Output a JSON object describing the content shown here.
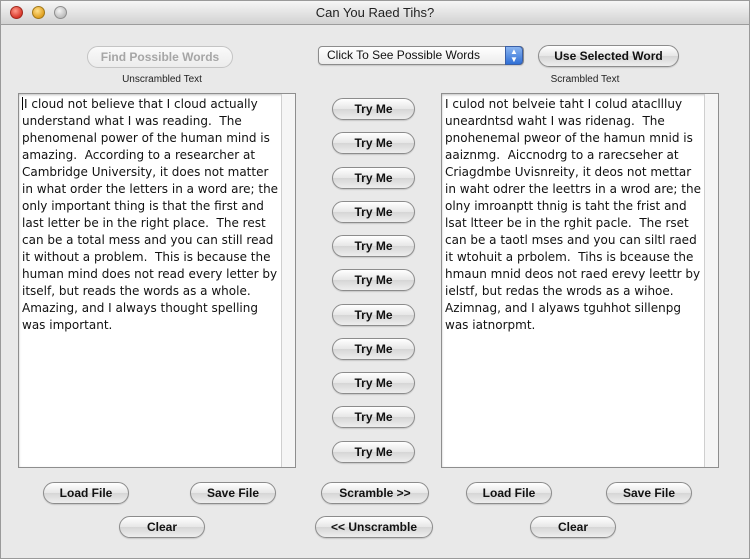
{
  "window": {
    "title": "Can You Raed Tihs?"
  },
  "top": {
    "find_words_label": "Find Possible Words",
    "popup_value": "Click To See Possible Words",
    "use_word_label": "Use Selected Word"
  },
  "left": {
    "heading": "Unscrambled Text",
    "text": "I cloud not believe that I cloud actually understand what I was reading.  The phenomenal power of the human mind is amazing.  According to a researcher at Cambridge University, it does not matter in what order the letters in a word are; the only important thing is that the first and last letter be in the right place.  The rest can be a total mess and you can still read it without a problem.  This is because the human mind does not read every letter by itself, but reads the words as a whole. Amazing, and I always thought spelling was important.",
    "load_label": "Load File",
    "save_label": "Save File",
    "clear_label": "Clear"
  },
  "right": {
    "heading": "Scrambled Text",
    "text": "I culod not belveie taht I colud atacllluy uneardntsd waht I was ridenag.  The pnohenemal pweor of the hamun mnid is aaiznmg.  Aiccnodrg to a rarecseher at Criagdmbe Uvisnreity, it deos not mettar in waht odrer the leettrs in a wrod are; the olny imroanptt thnig is taht the frist and lsat ltteer be in the rghit pacle.  The rset can be a taotl mses and you can siltl raed it wtohuit a prbolem.  Tihs is bceause the hmaun mnid deos not raed erevy leettr by ielstf, but redas the wrods as a wihoe. Azimnag, and I alyaws tguhhot sillenpg was iatnorpmt.",
    "load_label": "Load File",
    "save_label": "Save File",
    "clear_label": "Clear"
  },
  "middle": {
    "try_buttons": [
      "Try Me",
      "Try Me",
      "Try Me",
      "Try Me",
      "Try Me",
      "Try Me",
      "Try Me",
      "Try Me",
      "Try Me",
      "Try Me",
      "Try Me"
    ],
    "scramble_label": "Scramble >>",
    "unscramble_label": "<< Unscramble"
  },
  "icons": {
    "close": "close-button-icon",
    "minimize": "minimize-button-icon",
    "zoom": "zoom-button-icon",
    "popup_arrows": "up-down-arrows-icon"
  }
}
